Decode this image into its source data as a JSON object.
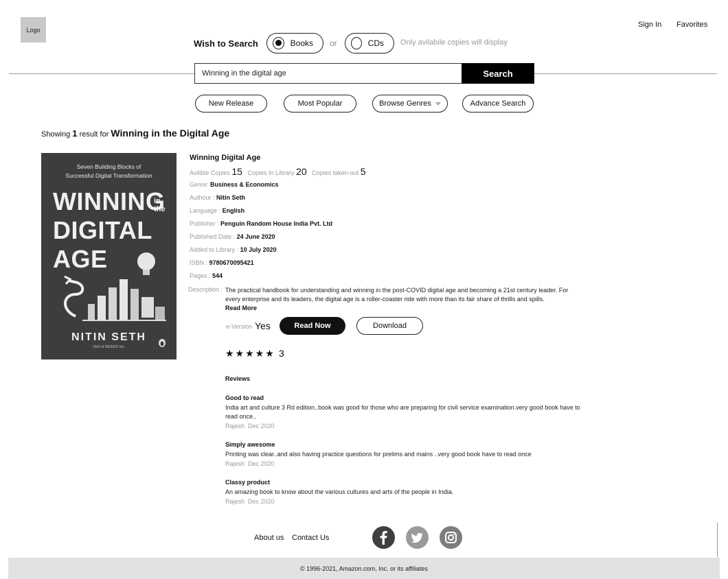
{
  "header": {
    "logo_label": "Logo",
    "sign_in": "Sign In",
    "favorites": "Favorites"
  },
  "search": {
    "wish_label": "Wish to Search",
    "option_books": "Books",
    "option_cds": "CDs",
    "selected": "Books",
    "or_text": "or",
    "note": "Only avilabile  copies will display",
    "query": "Winning in the digital age",
    "button": "Search"
  },
  "filters": {
    "new_release": "New Release",
    "most_popular": "Most Popular",
    "browse_genres": "Browse Genres",
    "advance_search": "Advance Search"
  },
  "results": {
    "prefix": "Showing",
    "count": "1",
    "middle": "result for",
    "query": "Winning in the Digital Age"
  },
  "book": {
    "cover": {
      "subtitle_line1": "Seven Building Blocks of",
      "subtitle_line2": "Successful Digital Transformation",
      "title_line1": "WINNING",
      "title_line2": "DIGITAL",
      "title_line3": "AGE",
      "in_the_1": "in",
      "in_the_2": "the",
      "author": "NITIN SETH",
      "author_caption": "CEO of INCEDO Inc."
    },
    "title": "Winning Digital Age",
    "available_label": "Avilible Copies",
    "available": "15",
    "in_library_label": "Copies In Library",
    "in_library": "20",
    "taken_label": "Copies taken-out",
    "taken": "5",
    "genre_label": "Genre:",
    "genre": "Business & Economics",
    "author_label": "Authour :",
    "author": "Nitin Seth",
    "language_label": "Language :",
    "language": "English",
    "publisher_label": "Publisher :",
    "publisher": "Penguin Random House India Pvt. Ltd",
    "published_label": "Published Date :",
    "published": "24 June 2020",
    "added_label": "Added to Library :",
    "added": "10 July 2020",
    "isbn_label": "ISBN :",
    "isbn": "9780670095421",
    "pages_label": "Pages :",
    "pages": "544",
    "description_label": "Description :",
    "description": "The practical handbook for understanding and winning in the post-COVID digital age and becoming a 21st century leader. For every enterprise and its leaders, the digital age is a roller-coaster ride with more than its fair share of thrills and spills.",
    "read_more": "Read More",
    "eversion_label": "e-Version",
    "eversion": "Yes",
    "read_now": "Read Now",
    "download": "Download",
    "stars": "★★★★★",
    "rating": "3"
  },
  "reviews": {
    "heading": "Reviews",
    "items": [
      {
        "title": "Good to read",
        "body": "India art and culture 3 Rd edition..book was good for those who are preparing for civil service examination.very good book have to read once..",
        "author": "Rajesh",
        "date": "Dec 2020"
      },
      {
        "title": "Simply awesome",
        "body": "Printing was clear..and also having practice questions for prelims and mains ..very good book have to read once",
        "author": "Rajesh",
        "date": "Dec 2020"
      },
      {
        "title": "Classy product",
        "body": "An amazing book to know about the various cultures and arts of the people in India.",
        "author": "Rajesh",
        "date": "Dec 2020"
      }
    ]
  },
  "footer": {
    "about": "About us",
    "contact": "Contact Us",
    "social_icons": [
      "facebook-icon",
      "twitter-icon",
      "instagram-icon"
    ],
    "copyright": "© 1996-2021, Amazon.com, Inc. or its affiliates"
  },
  "colors": {
    "primary": "#000000",
    "cover_bg": "#3d3d3d",
    "facebook": "#3f3f3f",
    "twitter": "#9a9a9a",
    "instagram": "#7d7d7d",
    "footer_bg": "#e2e2e2"
  }
}
